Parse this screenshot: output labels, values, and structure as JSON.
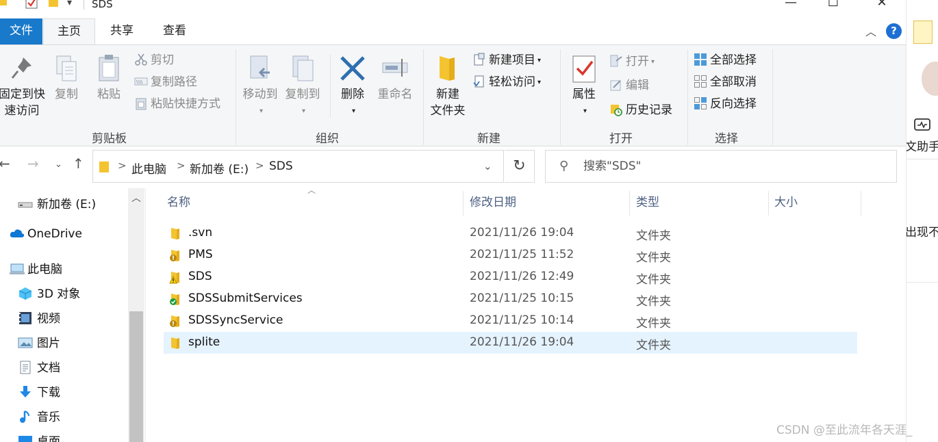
{
  "window": {
    "title": "SDS",
    "controls": {
      "minimize": "—",
      "maximize": "☐",
      "close": "✕"
    }
  },
  "tabs": [
    {
      "label": "文件"
    },
    {
      "label": "主页"
    },
    {
      "label": "共享"
    },
    {
      "label": "查看"
    }
  ],
  "ribbon": {
    "clipboard": {
      "label": "剪贴板",
      "pin_line1": "固定到快",
      "pin_line2": "速访问",
      "copy": "复制",
      "paste": "粘贴",
      "cut": "剪切",
      "copy_path": "复制路径",
      "paste_shortcut": "粘贴快捷方式"
    },
    "organize": {
      "label": "组织",
      "move_to": "移动到",
      "copy_to": "复制到",
      "delete": "删除",
      "rename": "重命名"
    },
    "new": {
      "label": "新建",
      "new_folder_line1": "新建",
      "new_folder_line2": "文件夹",
      "new_item": "新建项目",
      "easy_access": "轻松访问"
    },
    "open": {
      "label": "打开",
      "properties": "属性",
      "open": "打开",
      "edit": "编辑",
      "history": "历史记录"
    },
    "select": {
      "label": "选择",
      "select_all": "全部选择",
      "select_none": "全部取消",
      "invert": "反向选择"
    }
  },
  "address": {
    "crumbs": [
      "此电脑",
      "新加卷 (E:)",
      "SDS"
    ],
    "separator": ">"
  },
  "search": {
    "placeholder": "搜索\"SDS\""
  },
  "nav": {
    "items": [
      {
        "label": "新加卷 (E:)",
        "icon": "drive-icon"
      },
      {
        "label": "OneDrive",
        "icon": "cloud-icon"
      },
      {
        "label": "此电脑",
        "icon": "computer-icon"
      },
      {
        "label": "3D 对象",
        "icon": "cube-icon"
      },
      {
        "label": "视频",
        "icon": "video-icon"
      },
      {
        "label": "图片",
        "icon": "picture-icon"
      },
      {
        "label": "文档",
        "icon": "document-icon"
      },
      {
        "label": "下载",
        "icon": "download-icon"
      },
      {
        "label": "音乐",
        "icon": "music-icon"
      },
      {
        "label": "桌面",
        "icon": "desktop-icon"
      }
    ]
  },
  "filelist": {
    "columns": [
      "名称",
      "修改日期",
      "类型",
      "大小"
    ],
    "rows": [
      {
        "name": ".svn",
        "date": "2021/11/26 19:04",
        "type": "文件夹",
        "overlay": "none"
      },
      {
        "name": "PMS",
        "date": "2021/11/25 11:52",
        "type": "文件夹",
        "overlay": "modified"
      },
      {
        "name": "SDS",
        "date": "2021/11/26 12:49",
        "type": "文件夹",
        "overlay": "warning"
      },
      {
        "name": "SDSSubmitServices",
        "date": "2021/11/25 10:15",
        "type": "文件夹",
        "overlay": "normal"
      },
      {
        "name": "SDSSyncService",
        "date": "2021/11/25 10:14",
        "type": "文件夹",
        "overlay": "modified"
      },
      {
        "name": "splite",
        "date": "2021/11/26 19:04",
        "type": "文件夹",
        "overlay": "none",
        "selected": true
      }
    ]
  },
  "right_strip": {
    "text_assistant": "文助手",
    "text_appear": "出现不"
  },
  "watermark": "CSDN @至此流年各天涯_",
  "colors": {
    "file_tab": "#1979ca",
    "ribbon_bg": "#f5f6f7",
    "selected_row": "#e5f3ff",
    "folder": "#f4c430"
  }
}
